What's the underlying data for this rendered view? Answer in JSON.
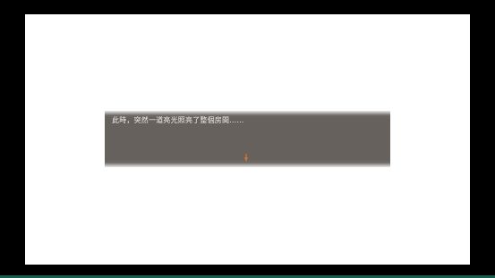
{
  "dialog": {
    "message": "此時，突然一道亮光照亮了整個房間……"
  },
  "colors": {
    "letterbox": "#000000",
    "screen_background": "#ffffff",
    "message_window": "#66615d",
    "message_text": "#f2f0ee",
    "continue_cursor": "#c8783c"
  },
  "icons": {
    "continue_cursor": "continue-arrow-icon"
  }
}
